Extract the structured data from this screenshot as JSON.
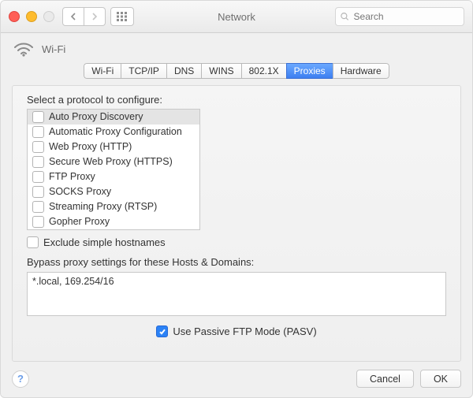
{
  "titlebar": {
    "title": "Network",
    "search_placeholder": "Search"
  },
  "header": {
    "interface_name": "Wi-Fi"
  },
  "tabs": [
    {
      "label": "Wi-Fi",
      "active": false
    },
    {
      "label": "TCP/IP",
      "active": false
    },
    {
      "label": "DNS",
      "active": false
    },
    {
      "label": "WINS",
      "active": false
    },
    {
      "label": "802.1X",
      "active": false
    },
    {
      "label": "Proxies",
      "active": true
    },
    {
      "label": "Hardware",
      "active": false
    }
  ],
  "panel": {
    "select_label": "Select a protocol to configure:",
    "protocols": [
      {
        "label": "Auto Proxy Discovery",
        "checked": false,
        "selected": true
      },
      {
        "label": "Automatic Proxy Configuration",
        "checked": false,
        "selected": false
      },
      {
        "label": "Web Proxy (HTTP)",
        "checked": false,
        "selected": false
      },
      {
        "label": "Secure Web Proxy (HTTPS)",
        "checked": false,
        "selected": false
      },
      {
        "label": "FTP Proxy",
        "checked": false,
        "selected": false
      },
      {
        "label": "SOCKS Proxy",
        "checked": false,
        "selected": false
      },
      {
        "label": "Streaming Proxy (RTSP)",
        "checked": false,
        "selected": false
      },
      {
        "label": "Gopher Proxy",
        "checked": false,
        "selected": false
      }
    ],
    "exclude_simple_hostnames": {
      "label": "Exclude simple hostnames",
      "checked": false
    },
    "bypass_label": "Bypass proxy settings for these Hosts & Domains:",
    "bypass_value": "*.local, 169.254/16",
    "ftp_passive": {
      "label": "Use Passive FTP Mode (PASV)",
      "checked": true
    }
  },
  "footer": {
    "cancel": "Cancel",
    "ok": "OK"
  }
}
